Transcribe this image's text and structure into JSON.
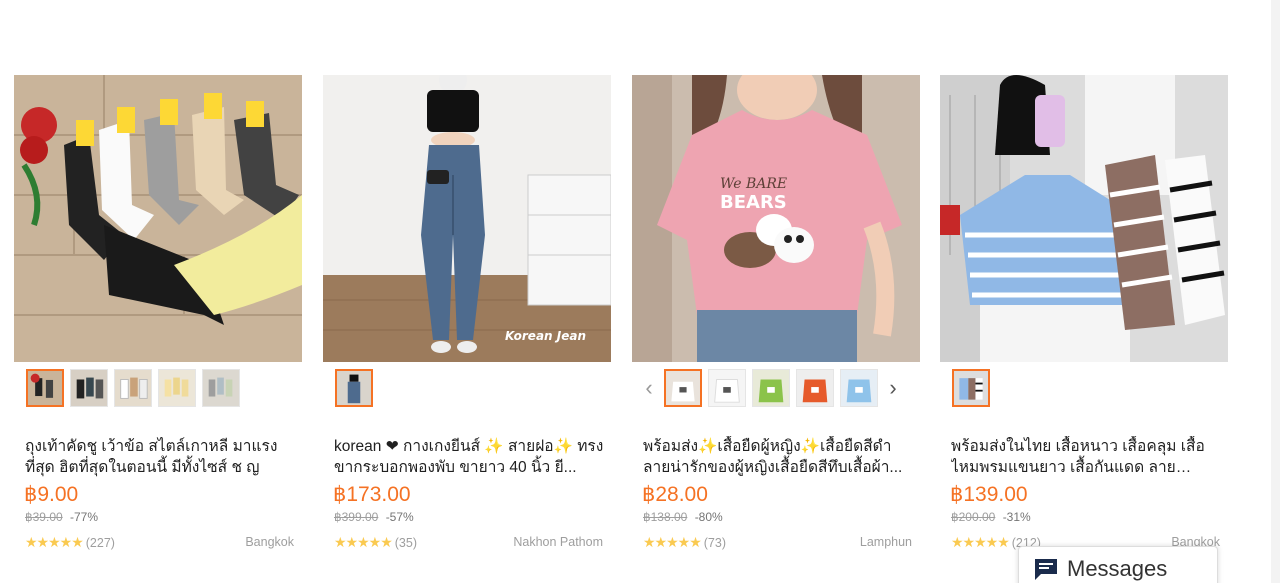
{
  "colors": {
    "accent": "#f57224",
    "star": "#faca51",
    "muted": "#9e9e9e"
  },
  "products": [
    {
      "title": "ถุงเท้าคัดชู เว้าข้อ สไตล์เกาหลี มาแรง ที่สุด ฮิตที่สุดในตอนนี้ มีทั้งไซส์ ช ญ",
      "price": "฿9.00",
      "original_price": "฿39.00",
      "discount": "-77%",
      "reviews": "(227)",
      "location": "Bangkok",
      "rating_stars": "★★★★★"
    },
    {
      "title": "korean ❤ กางเกงยีนส์ ✨ สายฝอ✨ ทรงขากระบอกพองพับ ขายาว 40 นิ้ว ยี...",
      "price": "฿173.00",
      "original_price": "฿399.00",
      "discount": "-57%",
      "reviews": "(35)",
      "location": "Nakhon Pathom",
      "image_caption": "Korean Jean",
      "rating_stars": "★★★★★"
    },
    {
      "title": "พร้อมส่ง✨เสื้อยืดผู้หญิง✨เสื้อยืดสีดำ ลายน่ารักของผู้หญิงเสื้อยืดสีทึบเสื้อผ้า...",
      "price": "฿28.00",
      "original_price": "฿138.00",
      "discount": "-80%",
      "reviews": "(73)",
      "location": "Lamphun",
      "image_caption_1": "We BARE",
      "image_caption_2": "BEARS",
      "rating_stars": "★★★★★"
    },
    {
      "title": "พร้อมส่งในไทย เสื้อหนาว เสื้อคลุม เสื้อไหมพรมแขนยาว เสื้อกันแดด ลายขวาง...",
      "price": "฿139.00",
      "original_price": "฿200.00",
      "discount": "-31%",
      "reviews": "(212)",
      "location": "Bangkok",
      "rating_stars": "★★★★★"
    }
  ],
  "nav": {
    "prev": "‹",
    "next": "›"
  },
  "messages": {
    "label": "Messages"
  }
}
